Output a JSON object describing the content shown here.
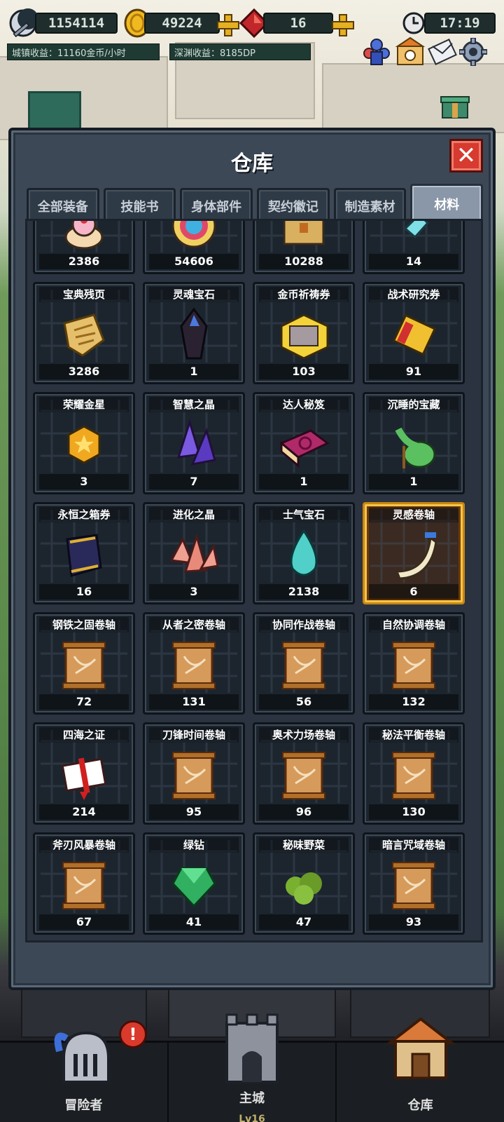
{
  "hud": {
    "power": "1154114",
    "gold": "49224",
    "gems": "16",
    "time": "17:19",
    "town_income": "城镇收益：11160金币/小时",
    "abyss_income": "深渊收益：8185DP"
  },
  "panel": {
    "title": "仓库",
    "close_symbol": "✕"
  },
  "tabs": [
    {
      "label": "全部装备",
      "active": false
    },
    {
      "label": "技能书",
      "active": false
    },
    {
      "label": "身体部件",
      "active": false
    },
    {
      "label": "契约徽记",
      "active": false
    },
    {
      "label": "制造素材",
      "active": false
    },
    {
      "label": "材料",
      "active": true
    }
  ],
  "items": [
    {
      "name": "",
      "count": "2386",
      "icon": "cake-icon"
    },
    {
      "name": "",
      "count": "54606",
      "icon": "rainbow-orb-icon"
    },
    {
      "name": "",
      "count": "10288",
      "icon": "chest-icon"
    },
    {
      "name": "",
      "count": "14",
      "icon": "crystal-shard-icon"
    },
    {
      "name": "宝典残页",
      "count": "3286",
      "icon": "torn-page-icon"
    },
    {
      "name": "灵魂宝石",
      "count": "1",
      "icon": "soul-gem-icon"
    },
    {
      "name": "金币祈祷券",
      "count": "103",
      "icon": "gold-ticket-icon"
    },
    {
      "name": "战术研究券",
      "count": "91",
      "icon": "tactics-ticket-icon"
    },
    {
      "name": "荣耀金星",
      "count": "3",
      "icon": "gold-star-icon"
    },
    {
      "name": "智慧之晶",
      "count": "7",
      "icon": "wisdom-crystal-icon"
    },
    {
      "name": "达人秘笈",
      "count": "1",
      "icon": "secret-book-icon"
    },
    {
      "name": "沉睡的宝藏",
      "count": "1",
      "icon": "treasure-sack-icon"
    },
    {
      "name": "永恒之箱券",
      "count": "16",
      "icon": "eternal-scroll-icon"
    },
    {
      "name": "进化之晶",
      "count": "3",
      "icon": "evolution-crystal-icon"
    },
    {
      "name": "士气宝石",
      "count": "2138",
      "icon": "morale-gem-icon"
    },
    {
      "name": "灵感卷轴",
      "count": "6",
      "icon": "inspiration-horn-icon",
      "selected": true
    },
    {
      "name": "钢铁之固卷轴",
      "count": "72",
      "icon": "scroll-icon"
    },
    {
      "name": "从者之密卷轴",
      "count": "131",
      "icon": "scroll-icon"
    },
    {
      "name": "协同作战卷轴",
      "count": "56",
      "icon": "scroll-icon"
    },
    {
      "name": "自然协调卷轴",
      "count": "132",
      "icon": "scroll-icon"
    },
    {
      "name": "四海之证",
      "count": "214",
      "icon": "certificate-icon"
    },
    {
      "name": "刀锋时间卷轴",
      "count": "95",
      "icon": "scroll-icon"
    },
    {
      "name": "奥术力场卷轴",
      "count": "96",
      "icon": "scroll-icon"
    },
    {
      "name": "秘法平衡卷轴",
      "count": "130",
      "icon": "scroll-icon"
    },
    {
      "name": "斧刃风暴卷轴",
      "count": "67",
      "icon": "scroll-icon"
    },
    {
      "name": "绿钻",
      "count": "41",
      "icon": "emerald-icon"
    },
    {
      "name": "秘味野菜",
      "count": "47",
      "icon": "herb-icon"
    },
    {
      "name": "暗言咒域卷轴",
      "count": "93",
      "icon": "scroll-icon"
    }
  ],
  "bottom_nav": [
    {
      "label": "冒险者",
      "icon": "knight-helmet-icon",
      "alert": "!"
    },
    {
      "label": "主城",
      "icon": "castle-tower-icon",
      "level": "Lv16"
    },
    {
      "label": "仓库",
      "icon": "warehouse-icon"
    }
  ],
  "colors": {
    "panel_bg": "#3c4856",
    "cell_bg": "#1c252e",
    "selected_border": "#f5c54a",
    "close_btn": "#d73a2e"
  }
}
